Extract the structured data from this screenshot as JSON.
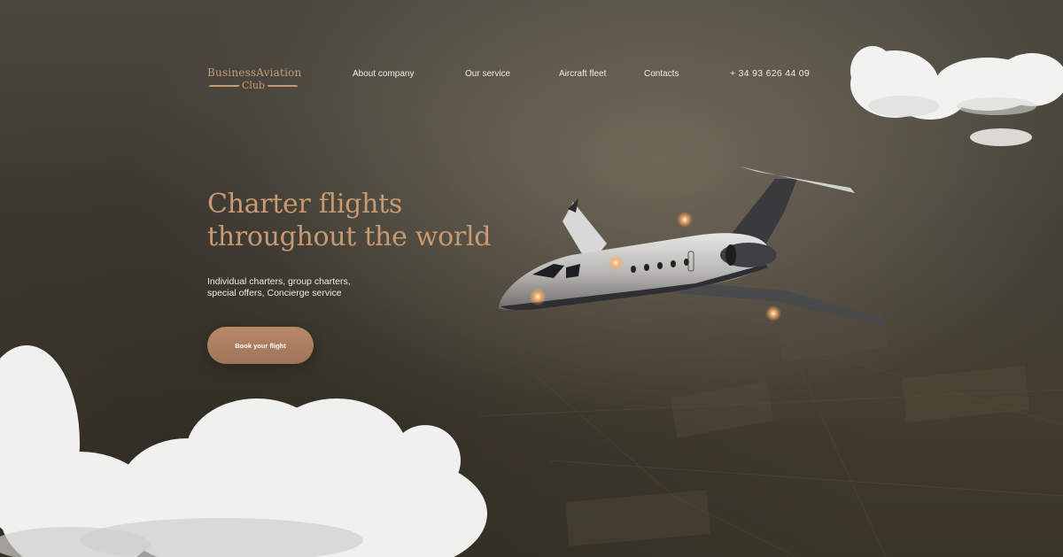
{
  "logo": {
    "line1": "BusinessAviation",
    "line2": "Club"
  },
  "nav": {
    "items": [
      {
        "label": "About company"
      },
      {
        "label": "Our service"
      },
      {
        "label": "Aircraft fleet"
      },
      {
        "label": "Contacts"
      }
    ],
    "phone": "+ 34 93 626 44 09"
  },
  "hero": {
    "title_line1": "Charter flights",
    "title_line2": "throughout the world",
    "subtitle_line1": "Individual charters, group charters,",
    "subtitle_line2": "special offers, Concierge service",
    "cta_label": "Book your flight"
  },
  "colors": {
    "accent": "#c79a74",
    "button": "#b08065",
    "text_light": "#f1ece4",
    "background": "#433e35"
  }
}
